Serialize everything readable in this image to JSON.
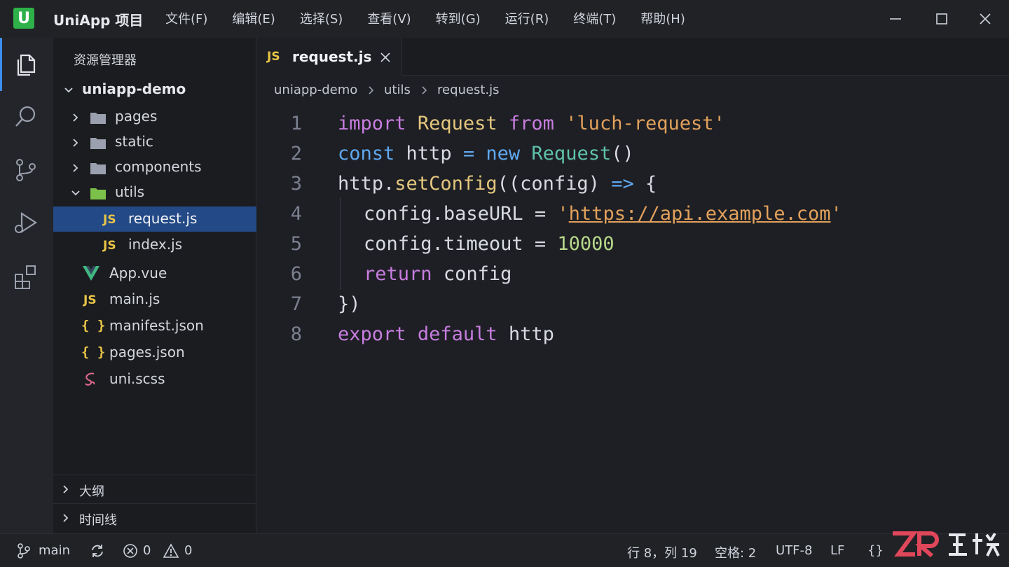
{
  "titlebar": {
    "app_title": "UniApp 项目",
    "logo_letter": "U",
    "menu": [
      "文件(F)",
      "编辑(E)",
      "选择(S)",
      "查看(V)",
      "转到(G)",
      "运行(R)",
      "终端(T)",
      "帮助(H)"
    ]
  },
  "activitybar": {
    "icons": [
      "explorer-icon",
      "search-icon",
      "source-control-icon",
      "run-debug-icon",
      "extensions-icon"
    ]
  },
  "sidebar": {
    "title": "资源管理器",
    "root": "uniapp-demo",
    "folders": [
      "pages",
      "static",
      "components",
      "utils"
    ],
    "utils_files": [
      "request.js",
      "index.js"
    ],
    "root_files": [
      "App.vue",
      "main.js",
      "manifest.json",
      "pages.json",
      "uni.scss"
    ],
    "file_badge_js": "JS",
    "file_badge_json": "{ }",
    "panels": [
      "大纲",
      "时间线"
    ]
  },
  "editor": {
    "tab_label": "request.js",
    "tab_badge": "JS",
    "breadcrumb": [
      "uniapp-demo",
      "utils",
      "request.js"
    ],
    "line_numbers": [
      "1",
      "2",
      "3",
      "4",
      "5",
      "6",
      "7",
      "8"
    ],
    "tokens": {
      "import": "import",
      "Request": "Request",
      "from": "from",
      "module": "'luch-request'",
      "const": "const",
      "http": "http",
      "eq": "=",
      "new": "new",
      "Request2": "Request",
      "paren": "()",
      "http3": "http",
      "dot": ".",
      "setConfig": "setConfig",
      "open3": "((",
      "config": "config",
      "close3": ")",
      "arrow": "=>",
      "brace": "{",
      "config4": "config",
      "dot4": ".",
      "baseURL": "baseURL",
      "eq4": "=",
      "q1": "'",
      "url": "https://api.example.com",
      "q2": "'",
      "config5": "config",
      "dot5": ".",
      "timeout": "timeout",
      "eq5": "=",
      "num": "10000",
      "return": "return",
      "config6": "config",
      "close7": "})",
      "export": "export",
      "default": "default",
      "http8": "http"
    }
  },
  "statusbar": {
    "branch": "main",
    "errors": "0",
    "warnings": "0",
    "position": "行 8，列 19",
    "indent": "空格: 2",
    "encoding": "UTF-8",
    "eol": "LF",
    "language_icon": "{}"
  },
  "colors": {
    "accent": "#3b8df0",
    "selected": "#234a86",
    "logo": "#2fb14a",
    "js_badge": "#e8c547"
  }
}
